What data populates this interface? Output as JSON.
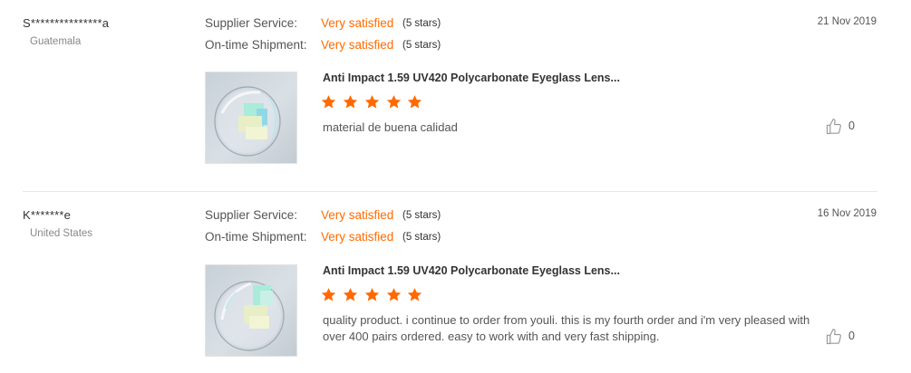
{
  "reviews": [
    {
      "buyer": {
        "name": "S***************a",
        "country": "Guatemala"
      },
      "supplier_service": {
        "label": "Supplier Service:",
        "value": "Very satisfied",
        "stars": "(5 stars)"
      },
      "shipment": {
        "label": "On-time Shipment:",
        "value": "Very satisfied",
        "stars": "(5 stars)"
      },
      "date": "21 Nov 2019",
      "product": {
        "title": "Anti Impact 1.59 UV420 Polycarbonate Eyeglass Lens...",
        "rating": 5
      },
      "comment": "material de buena calidad",
      "likes": "0"
    },
    {
      "buyer": {
        "name": "K*******e",
        "country": "United States"
      },
      "supplier_service": {
        "label": "Supplier Service:",
        "value": "Very satisfied",
        "stars": "(5 stars)"
      },
      "shipment": {
        "label": "On-time Shipment:",
        "value": "Very satisfied",
        "stars": "(5 stars)"
      },
      "date": "16 Nov 2019",
      "product": {
        "title": "Anti Impact 1.59 UV420 Polycarbonate Eyeglass Lens...",
        "rating": 5
      },
      "comment": "quality product.  i continue to order from youli.  this is my fourth order and i'm very pleased with over 400 pairs ordered.  easy to work with and very fast shipping.",
      "likes": "0"
    }
  ],
  "colors": {
    "accent": "#ff6a00",
    "divider": "#e6e6e6",
    "muted": "#888888"
  },
  "icons": {
    "star": "star-icon",
    "like": "thumbs-up-icon"
  }
}
